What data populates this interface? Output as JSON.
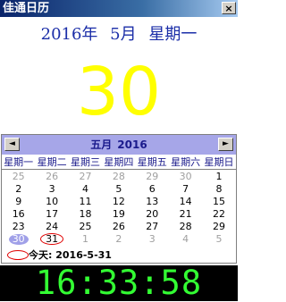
{
  "window": {
    "title": "佳通日历",
    "close_label": "×"
  },
  "header": {
    "year": "2016年",
    "month": "5月",
    "weekday": "星期一",
    "day": "30"
  },
  "calendar": {
    "month_label": "五月",
    "year_label": "2016",
    "prev_icon": "◄",
    "next_icon": "►",
    "weekdays": [
      "星期一",
      "星期二",
      "星期三",
      "星期四",
      "星期五",
      "星期六",
      "星期日"
    ],
    "weeks": [
      [
        "25",
        "26",
        "27",
        "28",
        "29",
        "30",
        "1"
      ],
      [
        "2",
        "3",
        "4",
        "5",
        "6",
        "7",
        "8"
      ],
      [
        "9",
        "10",
        "11",
        "12",
        "13",
        "14",
        "15"
      ],
      [
        "16",
        "17",
        "18",
        "19",
        "20",
        "21",
        "22"
      ],
      [
        "23",
        "24",
        "25",
        "26",
        "27",
        "28",
        "29"
      ],
      [
        "30",
        "31",
        "1",
        "2",
        "3",
        "4",
        "5"
      ]
    ],
    "today_label": "今天: 2016-5-31",
    "selected_color": "#a0a0e8",
    "today_circle_color": "#e00000"
  },
  "clock": {
    "time": "16:33:58",
    "color": "#33ff33"
  }
}
